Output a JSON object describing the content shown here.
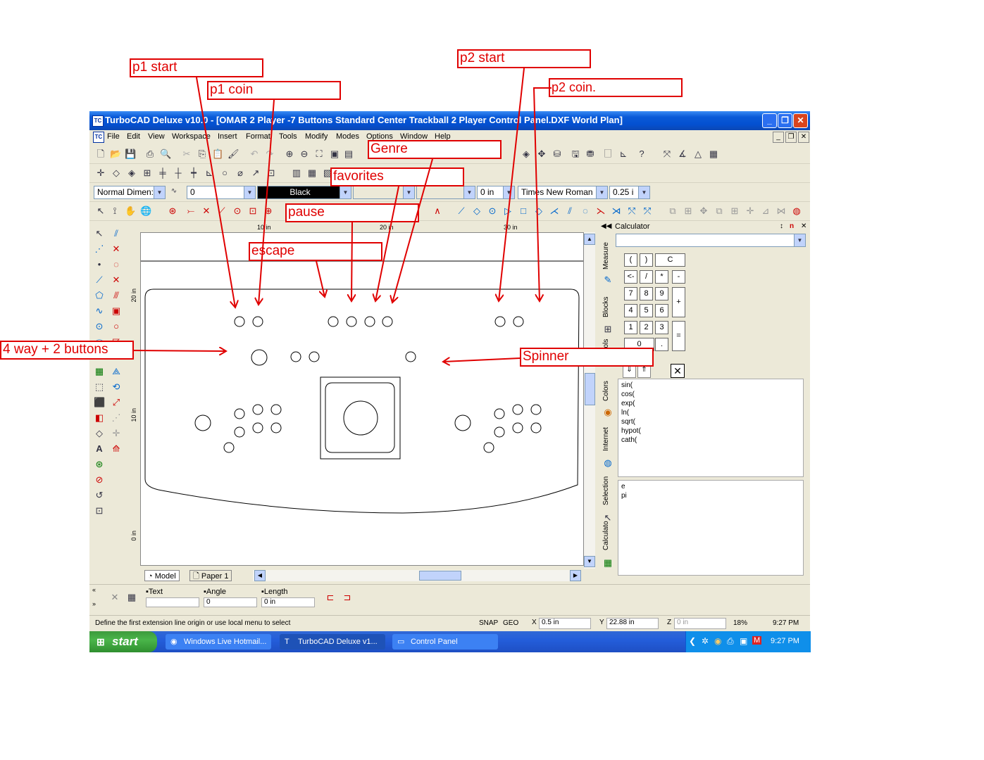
{
  "window": {
    "title": "TurboCAD Deluxe v10.0 - [OMAR 2 Player -7 Buttons Standard Center Trackball 2 Player Control Panel.DXF World Plan]",
    "icon": "TC",
    "minimize": "_",
    "restore": "❐",
    "close": "✕"
  },
  "menu": [
    "File",
    "Edit",
    "View",
    "Workspace",
    "Insert",
    "Format",
    "Tools",
    "Modify",
    "Modes",
    "Options",
    "Window",
    "Help"
  ],
  "properties_bar": {
    "dim_style": "Normal Dimen:",
    "value_zero": "0",
    "color": "Black",
    "line_width": "0 in",
    "font": "Times New Roman",
    "text_height": "0.25 i"
  },
  "rulers": {
    "h_ticks": [
      "10 in",
      "20 in",
      "30 in"
    ],
    "v_ticks": [
      "20 in",
      "10 in",
      "0 in"
    ]
  },
  "tabs": {
    "model": "Model",
    "paper": "Paper 1"
  },
  "calculator": {
    "title": "Calculator",
    "side_tabs": [
      "Measure",
      "Blocks",
      "ools",
      "Colors",
      "Internet",
      "Selection",
      "Calculato"
    ],
    "keys": [
      "(",
      ")",
      "C",
      "<-",
      "/",
      "*",
      "-",
      "7",
      "8",
      "9",
      "+",
      "4",
      "5",
      "6",
      "1",
      "2",
      "3",
      "=",
      "0",
      "."
    ],
    "functions": [
      "sin(",
      "cos(",
      "exp(",
      "ln(",
      "sqrt(",
      "hypot(",
      "cath("
    ],
    "constants": [
      "e",
      "pi"
    ]
  },
  "inspector": {
    "text_label": "Text",
    "angle_label": "Angle",
    "angle_value": "0",
    "length_label": "Length",
    "length_value": "0 in"
  },
  "status": {
    "prompt": "Define the first extension line origin or use local menu to select",
    "snap": "SNAP",
    "geo": "GEO",
    "x": "0.5 in",
    "y": "22.88 in",
    "z": "0 in",
    "zoom": "18%",
    "time": "9:27 PM"
  },
  "taskbar": {
    "start": "start",
    "tasks": [
      "Windows Live Hotmail...",
      "TurboCAD Deluxe v1...",
      "Control Panel"
    ],
    "clock": "9:27 PM"
  },
  "annotations": {
    "p1_start": "p1 start",
    "p1_coin": "p1 coin",
    "p2_start": "p2 start",
    "p2_coin": "p2 coin.",
    "genre": "Genre",
    "favorites": "favorites",
    "pause": "pause",
    "escape": "escape",
    "four_way": "4 way + 2 buttons",
    "spinner": "Spinner"
  },
  "colors": {
    "annotation": "#e00000",
    "title_blue": "#0a5ad8",
    "chrome": "#ece9d8"
  }
}
